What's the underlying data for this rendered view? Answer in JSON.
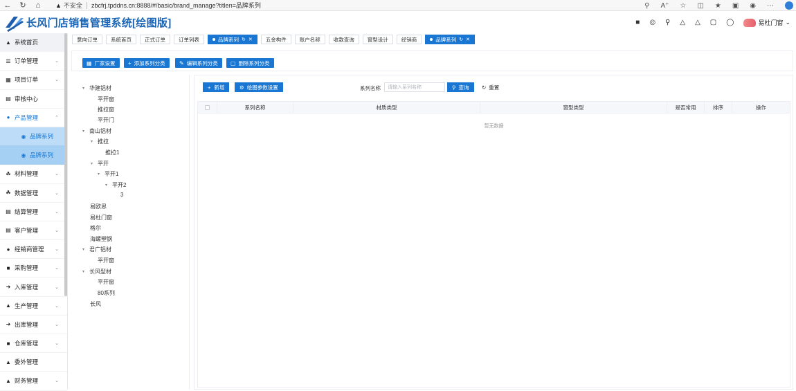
{
  "browser": {
    "insecure_label": "不安全",
    "url": "zbcfrj.tpddns.cn:8888/#/basic/brand_manage?titlen=品牌系列"
  },
  "app": {
    "title": "长风门店销售管理系统[绘图版]",
    "user": "易杜门窗",
    "logo_colors": [
      "#1f5fb0",
      "#5aa0e8"
    ]
  },
  "sidebar": {
    "items": [
      {
        "label": "系统首页",
        "icon": "home-icon"
      },
      {
        "label": "订单管理",
        "icon": "list-icon",
        "chevron": "down"
      },
      {
        "label": "项目订单",
        "icon": "grid-icon",
        "chevron": "down"
      },
      {
        "label": "审核中心",
        "icon": "chart-icon"
      },
      {
        "label": "产品管理",
        "icon": "users-icon",
        "chevron": "up"
      },
      {
        "label": "品牌系列",
        "icon": "db-icon"
      },
      {
        "label": "品牌系列",
        "icon": "db-icon"
      },
      {
        "label": "材料管理",
        "icon": "share-icon",
        "chevron": "down"
      },
      {
        "label": "数据管理",
        "icon": "share-icon",
        "chevron": "down"
      },
      {
        "label": "结算管理",
        "icon": "chart-icon",
        "chevron": "down"
      },
      {
        "label": "客户管理",
        "icon": "card-icon",
        "chevron": "down"
      },
      {
        "label": "经销商管理",
        "icon": "users-icon",
        "chevron": "down"
      },
      {
        "label": "采购管理",
        "icon": "truck-icon",
        "chevron": "down"
      },
      {
        "label": "入库管理",
        "icon": "login-icon",
        "chevron": "down"
      },
      {
        "label": "生产管理",
        "icon": "sitemap-icon",
        "chevron": "down"
      },
      {
        "label": "出库管理",
        "icon": "logout-icon",
        "chevron": "down"
      },
      {
        "label": "仓库管理",
        "icon": "box-icon",
        "chevron": "down"
      },
      {
        "label": "委外管理",
        "icon": "sitemap-icon"
      },
      {
        "label": "财务管理",
        "icon": "sitemap-icon",
        "chevron": "down"
      }
    ]
  },
  "tabs": [
    {
      "label": "意向订单"
    },
    {
      "label": "系统首页"
    },
    {
      "label": "正式订单"
    },
    {
      "label": "订单列表"
    },
    {
      "label": "品牌系列",
      "active": true
    },
    {
      "label": "五金构件"
    },
    {
      "label": "账户名称"
    },
    {
      "label": "收款查询"
    },
    {
      "label": "窗型设计"
    },
    {
      "label": "经销商"
    },
    {
      "label": "品牌系列",
      "active": true
    }
  ],
  "toolbar": {
    "factory_settings": "厂家设置",
    "add_series_category": "添加系列分类",
    "edit_series_category": "编辑系列分类",
    "delete_series_category": "删除系列分类"
  },
  "tree": [
    {
      "label": "华建铝材",
      "level": 0,
      "arrow": true
    },
    {
      "label": "平开窗",
      "level": 1
    },
    {
      "label": "推拉窗",
      "level": 1
    },
    {
      "label": "平开门",
      "level": 1
    },
    {
      "label": "南山铝材",
      "level": 0,
      "arrow": true
    },
    {
      "label": "推拉",
      "level": 1,
      "arrow": true
    },
    {
      "label": "推拉1",
      "level": 2
    },
    {
      "label": "平开",
      "level": 1,
      "arrow": true
    },
    {
      "label": "平开1",
      "level": 2,
      "arrow": true
    },
    {
      "label": "平开2",
      "level": 3,
      "arrow": true
    },
    {
      "label": "3",
      "level": 4
    },
    {
      "label": "易欧思",
      "level": 0
    },
    {
      "label": "易杜门窗",
      "level": 0
    },
    {
      "label": "格尔",
      "level": 0
    },
    {
      "label": "海螺塑钢",
      "level": 0
    },
    {
      "label": "君广铝材",
      "level": 0,
      "arrow": true
    },
    {
      "label": "平开窗",
      "level": 1
    },
    {
      "label": "长风型材",
      "level": 0,
      "arrow": true
    },
    {
      "label": "平开窗",
      "level": 1
    },
    {
      "label": "80系列",
      "level": 1
    },
    {
      "label": "长风",
      "level": 0
    }
  ],
  "main": {
    "add_label": "新增",
    "draw_params_label": "绘图参数设置",
    "search_label": "系列名称",
    "search_placeholder": "请输入系列名称",
    "query_label": "查询",
    "reset_label": "重置",
    "columns": [
      "系列名称",
      "材质类型",
      "窗型类型",
      "是否常用",
      "排序",
      "操作"
    ],
    "empty_text": "暂无数据"
  }
}
